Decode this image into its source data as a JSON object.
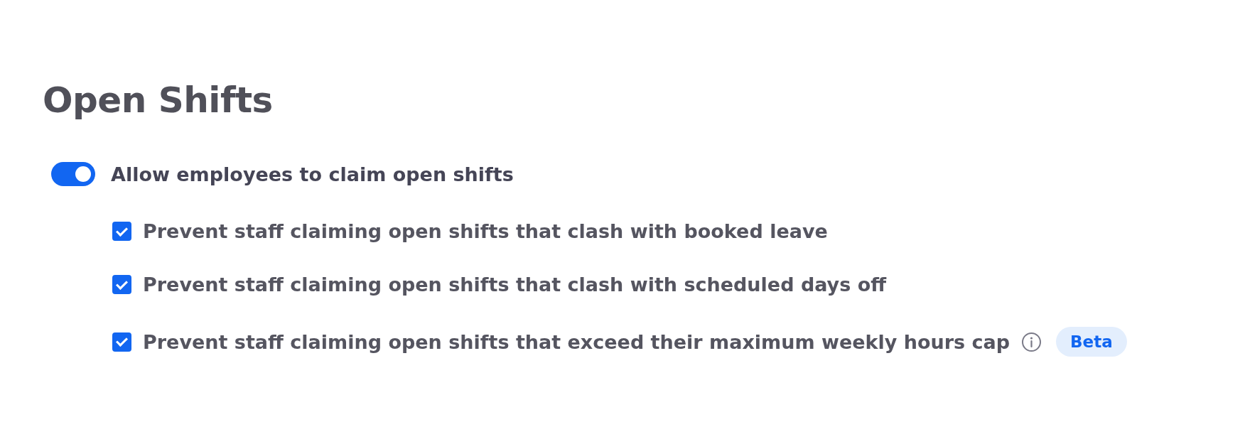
{
  "title": "Open Shifts",
  "toggle": {
    "label": "Allow employees to claim open shifts",
    "on": true
  },
  "options": [
    {
      "label": "Prevent staff claiming open shifts that clash with booked leave",
      "checked": true
    },
    {
      "label": "Prevent staff claiming open shifts that clash with scheduled days off",
      "checked": true
    },
    {
      "label": "Prevent staff claiming open shifts that exceed their maximum weekly hours cap",
      "checked": true,
      "info": true,
      "badge": "Beta"
    }
  ]
}
